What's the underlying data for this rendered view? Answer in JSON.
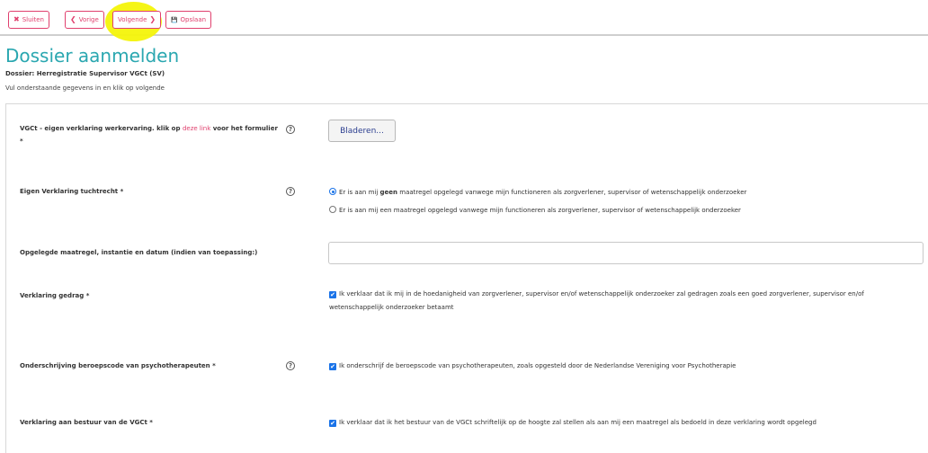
{
  "toolbar": {
    "close": {
      "icon": "✖",
      "label": "Sluiten"
    },
    "prev": {
      "icon": "❮",
      "label": "Vorige"
    },
    "next": {
      "icon": "❯",
      "label": "Volgende"
    },
    "save": {
      "icon": "💾",
      "label": "Opslaan"
    }
  },
  "page": {
    "title": "Dossier aanmelden",
    "subtitle": "Dossier: Herregistratie Supervisor VGCt (SV)",
    "instruction": "Vul onderstaande gegevens in en klik op volgende"
  },
  "fields": {
    "verklaring_werkervaring": {
      "label_pre": "VGCt - eigen verklaring werkervaring. klik op ",
      "link": "deze link",
      "label_post": " voor het formulier *",
      "button": "Bladeren..."
    },
    "tuchtrecht": {
      "label": "Eigen Verklaring tuchtrecht *",
      "option1_pre": "Er is aan mij ",
      "option1_bold": "geen",
      "option1_post": " maatregel opgelegd vanwege mijn functioneren als zorgverlener, supervisor of wetenschappelijk onderzoeker",
      "option2": "Er is aan mij een maatregel opgelegd vanwege mijn functioneren als zorgverlener, supervisor of wetenschappelijk onderzoeker"
    },
    "maatregel": {
      "label": "Opgelegde maatregel, instantie en datum (indien van toepassing:)",
      "value": ""
    },
    "gedrag": {
      "label": "Verklaring gedrag  *",
      "text": "Ik verklaar dat ik mij in de hoedanigheid van zorgverlener, supervisor en/of wetenschappelijk onderzoeker zal gedragen zoals een goed zorgverlener, supervisor en/of wetenschappelijk onderzoeker betaamt"
    },
    "beroepscode": {
      "label": "Onderschrijving beroepscode van psychotherapeuten *",
      "text": "Ik onderschrijf de beroepscode van psychotherapeuten, zoals opgesteld door de Nederlandse Vereniging voor Psychotherapie"
    },
    "bestuur": {
      "label": "Verklaring aan bestuur van de VGCt  *",
      "text": "Ik verklaar dat ik het bestuur van de VGCt schriftelijk op de hoogte zal stellen als aan mij een maatregel als bedoeld in deze verklaring wordt opgelegd"
    }
  },
  "help_glyph": "?",
  "check_glyph": "✔"
}
